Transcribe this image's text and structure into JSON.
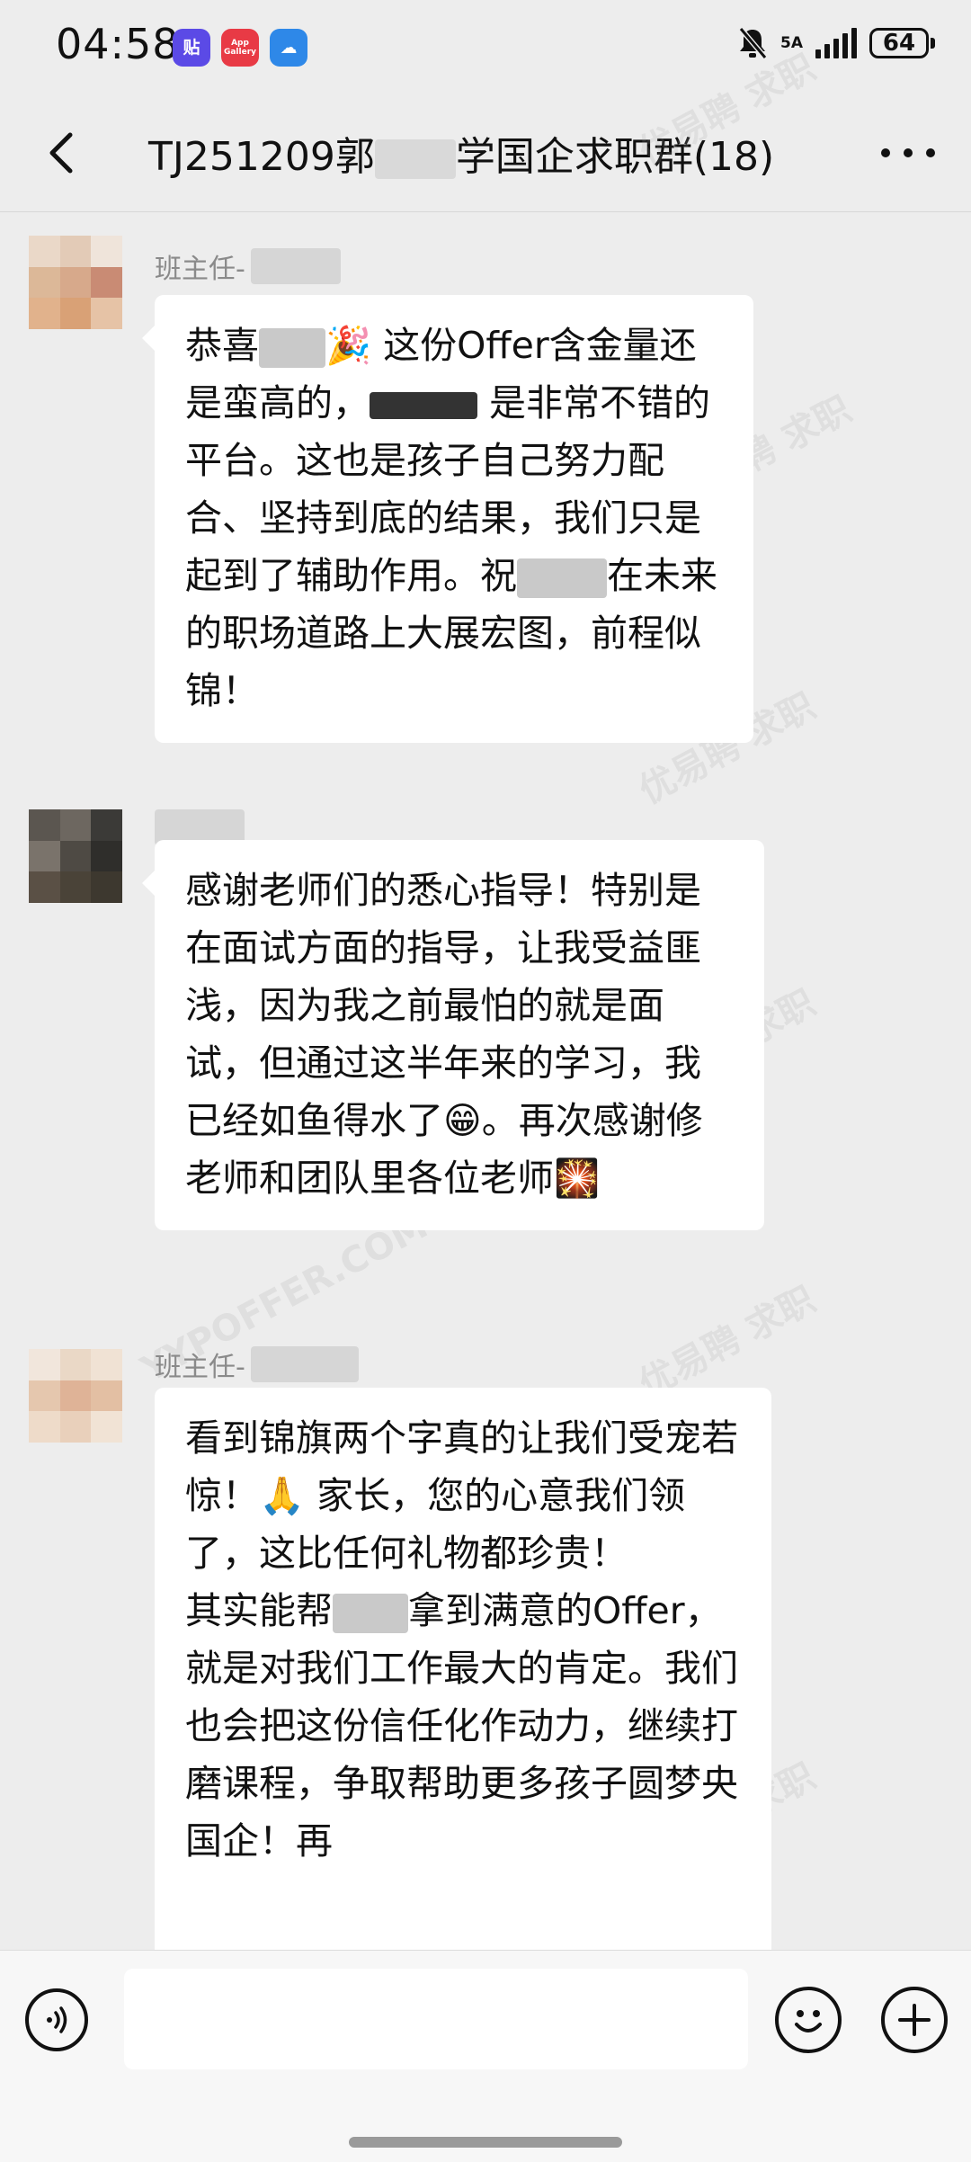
{
  "status_bar": {
    "time": "04:58",
    "app_icons": [
      {
        "name": "tieba-app-icon",
        "glyph": "贴"
      },
      {
        "name": "app-gallery-icon",
        "glyph": "App Gallery"
      },
      {
        "name": "weather-app-icon",
        "glyph": "☁"
      }
    ],
    "network": "5A",
    "battery": "64"
  },
  "header": {
    "title": "TJ251209郭",
    "title_tail": "学国企求职群(18)"
  },
  "watermark": {
    "text": "优易聘 求职",
    "sub": "YYPOFFER.COM"
  },
  "messages": [
    {
      "sender": "班主任-",
      "segments": [
        {
          "text": "恭喜"
        },
        {
          "mask": true
        },
        {
          "text": "🎉 这份Offer含金量还是蛮高的，"
        },
        {
          "mask": true,
          "dark": true
        },
        {
          "text": " 是非常不错的平台。这也是孩子自己努力配合、坚持到底的结果，我们只是起到了辅助作用。祝"
        },
        {
          "mask": true
        },
        {
          "text": "在未来的职场道路上大展宏图，前程似锦！"
        }
      ]
    },
    {
      "sender": "",
      "segments": [
        {
          "text": "感谢老师们的悉心指导！特别是在面试方面的指导，让我受益匪浅，因为我之前最怕的就是面试，但通过这半年来的学习，我已经如鱼得水了😁。再次感谢修老师和团队里各位老师🎇"
        }
      ]
    },
    {
      "sender": "班主任-",
      "segments": [
        {
          "text": "看到锦旗两个字真的让我们受宠若惊！🙏 家长，您的心意我们领了，这比任何礼物都珍贵！\n其实能帮"
        },
        {
          "mask": true
        },
        {
          "text": "拿到满意的Offer，就是对我们工作最大的肯定。我们也会把这份信任化作动力，继续打磨课程，争取帮助更多孩子圆梦央国企！再"
        }
      ]
    }
  ],
  "input_bar": {
    "voice_icon": "voice-icon",
    "emoji_icon": "emoji-icon",
    "plus_icon": "plus-icon",
    "placeholder": ""
  }
}
